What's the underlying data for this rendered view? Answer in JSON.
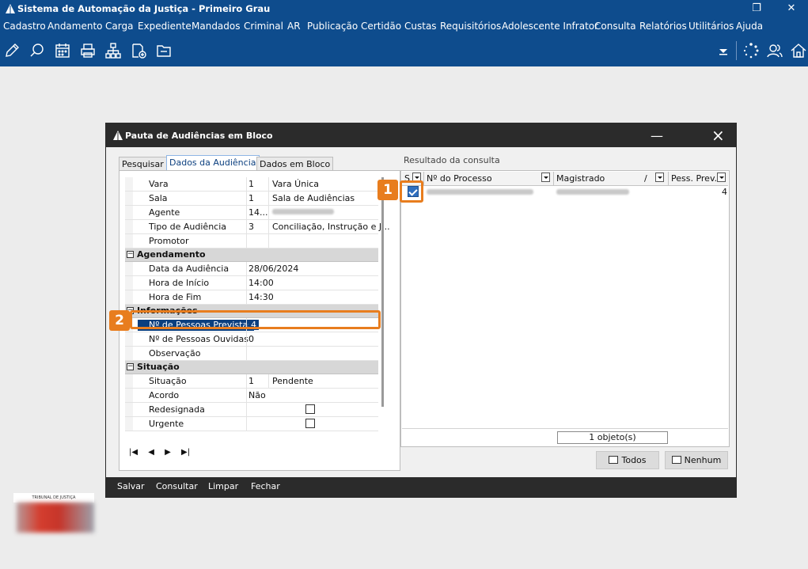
{
  "app": {
    "title": "Sistema de Automação da Justiça - Primeiro Grau",
    "window_buttons": {
      "restore": "❐",
      "close": "✕"
    }
  },
  "menu": [
    "Cadastro",
    "Andamento",
    "Carga",
    "Expediente",
    "Mandados",
    "Criminal",
    "AR",
    "Publicação",
    "Certidão",
    "Custas",
    "Requisitórios",
    "Adolescente Infrator",
    "Consulta",
    "Relatórios",
    "Utilitários",
    "Ajuda"
  ],
  "toolbar_icons": [
    "edit-icon",
    "search-document-icon",
    "calendar-icon",
    "printer-icon",
    "org-chart-icon",
    "add-document-icon",
    "folder-icon"
  ],
  "colors": {
    "app_blue": "#0e4c8d",
    "dialog_dark": "#2b2b2b",
    "highlight_orange": "#e87d1e",
    "selection_blue": "#0b3f7f"
  },
  "dialog": {
    "title": "Pauta de Audiências em Bloco",
    "tabs": [
      "Pesquisar",
      "Dados da Audiência",
      "Dados em Bloco"
    ],
    "active_tab": 1,
    "fields_top": [
      {
        "label": "Vara",
        "code": "1",
        "value": "Vara Única"
      },
      {
        "label": "Sala",
        "code": "1",
        "value": "Sala de Audiências"
      },
      {
        "label": "Agente",
        "code": "14...",
        "value": ""
      },
      {
        "label": "Tipo de Audiência",
        "code": "3",
        "value": "Conciliação, Instrução e J..."
      },
      {
        "label": "Promotor",
        "code": "",
        "value": ""
      }
    ],
    "section_agendamento": "Agendamento",
    "agendamento": [
      {
        "label": "Data da Audiência",
        "value": "28/06/2024"
      },
      {
        "label": "Hora de Início",
        "value": "14:00"
      },
      {
        "label": "Hora de Fim",
        "value": "14:30"
      }
    ],
    "section_informacoes": "Informações",
    "informacoes": [
      {
        "label": "Nº de Pessoas Previstas",
        "value": "4"
      },
      {
        "label": "Nº de Pessoas Ouvidas",
        "value": "0"
      },
      {
        "label": "Observação",
        "value": ""
      }
    ],
    "section_situacao": "Situação",
    "situacao": [
      {
        "label": "Situação",
        "code": "1",
        "value": "Pendente"
      },
      {
        "label": "Acordo",
        "code": "Não",
        "value": ""
      },
      {
        "label": "Redesignada",
        "checked": false
      },
      {
        "label": "Urgente",
        "checked": false
      }
    ],
    "nav": [
      "|◀",
      "◀",
      "▶",
      "▶|"
    ],
    "result_label": "Resultado da consulta",
    "result_columns": [
      "S",
      "Nº do Processo",
      "Magistrado",
      "Pess. Prev."
    ],
    "result_rows": [
      {
        "selected": true,
        "pess_prev": "4"
      }
    ],
    "status": "1 objeto(s)",
    "btn_todos": "Todos",
    "btn_nenhum": "Nenhum",
    "footer": [
      "Salvar",
      "Consultar",
      "Limpar",
      "Fechar"
    ]
  },
  "callouts": [
    "1",
    "2"
  ],
  "seal_text": "TRIBUNAL DE JUSTIÇA"
}
